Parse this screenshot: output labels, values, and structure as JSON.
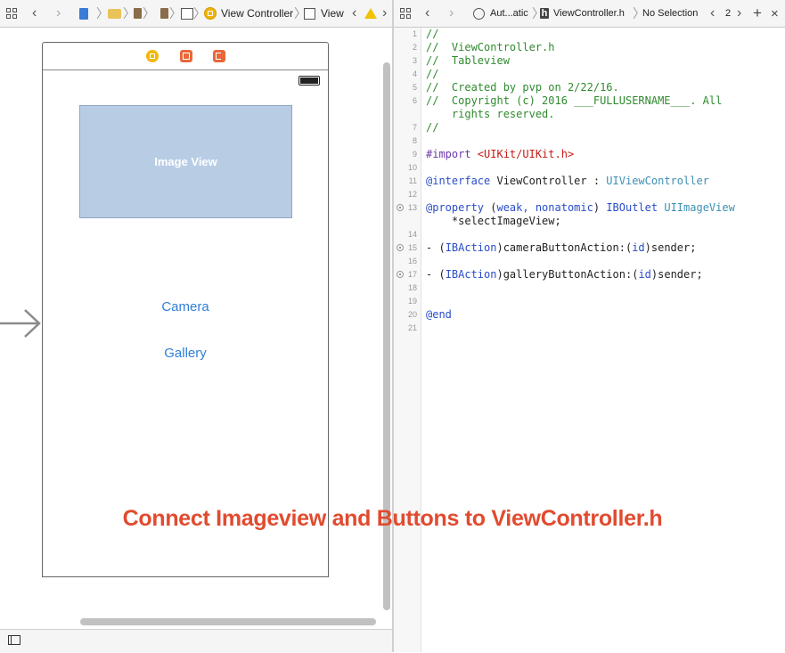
{
  "left_toolbar": {
    "breadcrumb_view_controller": "View Controller",
    "breadcrumb_view": "View"
  },
  "right_toolbar": {
    "automatic": "Aut...atic",
    "file": "ViewController.h",
    "selection": "No Selection",
    "counterparts": "2"
  },
  "scene": {
    "image_view_label": "Image View",
    "camera_button": "Camera",
    "gallery_button": "Gallery"
  },
  "editor": {
    "line_numbers": [
      "1",
      "2",
      "3",
      "4",
      "5",
      "6",
      "",
      "7",
      "8",
      "9",
      "10",
      "11",
      "12",
      "13",
      "",
      "14",
      "15",
      "16",
      "17",
      "18",
      "19",
      "20",
      "21"
    ],
    "lines": {
      "l1": "//",
      "l2": "//  ViewController.h",
      "l3": "//  Tableview",
      "l4": "//",
      "l5": "//  Created by pvp on 2/22/16.",
      "l6a": "//  Copyright (c) 2016 ___FULLUSERNAME___. All",
      "l6b": "    rights reserved.",
      "l7": "//",
      "l9_kw": "#import",
      "l9_str": " <UIKit/UIKit.h>",
      "l11_kw": "@interface",
      "l11_mid": " ViewController : ",
      "l11_type": "UIViewController",
      "l13_kw": "@property",
      "l13_p1": " (",
      "l13_attr": "weak, nonatomic",
      "l13_p2": ") ",
      "l13_outlet": "IBOutlet",
      "l13_sp": " ",
      "l13_type": "UIImageView",
      "l13b": "    *selectImageView;",
      "l15_a": "- (",
      "l15_ib": "IBAction",
      "l15_b": ")cameraButtonAction:(",
      "l15_id": "id",
      "l15_c": ")sender;",
      "l17_a": "- (",
      "l17_ib": "IBAction",
      "l17_b": ")galleryButtonAction:(",
      "l17_id": "id",
      "l17_c": ")sender;",
      "l20": "@end"
    }
  },
  "overlay_caption": "Connect Imageview and Buttons to ViewController.h",
  "colors": {
    "accent_button": "#2f7fd8",
    "caption": "#e14b2f",
    "comment": "#2f8a2f",
    "keyword": "#2a4dc8",
    "string": "#c41a16",
    "type": "#3e8fb0",
    "image_view_fill": "#b8cce4"
  },
  "icons": [
    "related-items-icon",
    "back-icon",
    "forward-icon",
    "objc-file-icon",
    "folder-icon",
    "storyboard-file-icon",
    "scene-icon",
    "view-controller-icon",
    "view-icon",
    "warning-icon",
    "add-editor-icon",
    "header-file-icon",
    "automatic-icon",
    "first-responder-icon",
    "exit-icon",
    "cube-icon",
    "entry-arrow-icon",
    "panel-toggle-icon"
  ]
}
